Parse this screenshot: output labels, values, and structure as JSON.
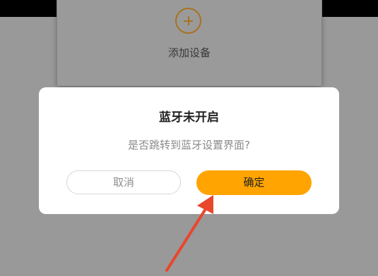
{
  "background": {
    "add_device_label": "添加设备",
    "add_icon": "plus-circle-icon"
  },
  "dialog": {
    "title": "蓝牙未开启",
    "message": "是否跳转到蓝牙设置界面?",
    "cancel_label": "取消",
    "confirm_label": "确定"
  },
  "colors": {
    "overlay": "#999999",
    "accent": "#ffa400",
    "arrow": "#e8472e"
  }
}
